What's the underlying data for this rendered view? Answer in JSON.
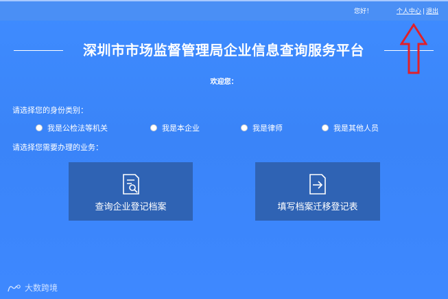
{
  "topbar": {
    "greeting": "您好！",
    "personal_center": "个人中心",
    "separator": "|",
    "logout": "退出"
  },
  "header": {
    "title": "深圳市市场监督管理局企业信息查询服务平台"
  },
  "welcome": "欢迎您：",
  "identity": {
    "label": "请选择您的身份类别：",
    "options": [
      "我是公检法等机关",
      "我是本企业",
      "我是律师",
      "我是其他人员"
    ]
  },
  "business": {
    "label": "请选择您需要办理的业务：",
    "cards": [
      {
        "label": "查询企业登记档案",
        "icon": "document-search-icon"
      },
      {
        "label": "填写档案迁移登记表",
        "icon": "document-transfer-icon"
      }
    ]
  },
  "watermark": {
    "text": "大数跨境"
  },
  "colors": {
    "background": "#3f8cff",
    "card": "#2f63b4",
    "annotation_arrow": "#e0202a"
  }
}
